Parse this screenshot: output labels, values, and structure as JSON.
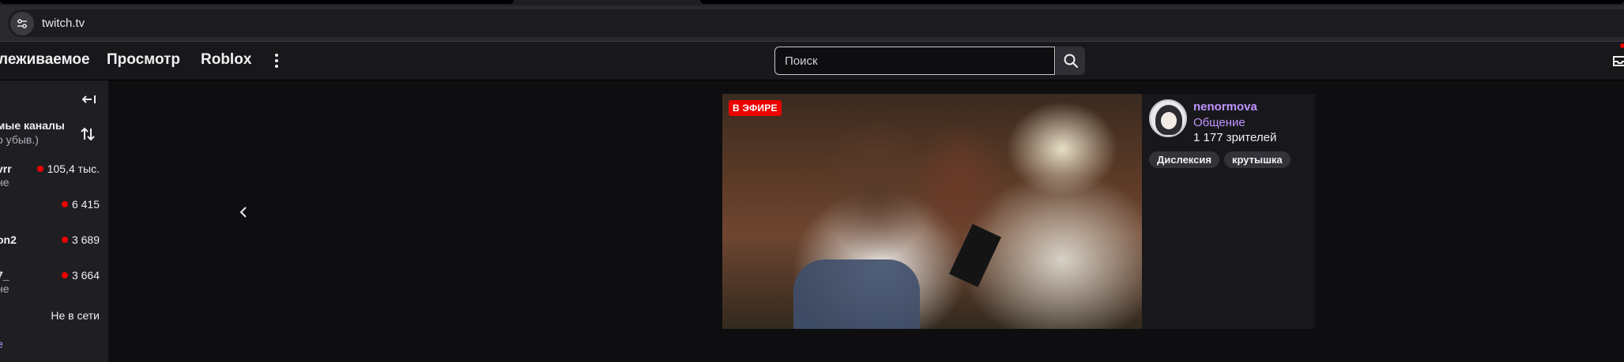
{
  "browser": {
    "url": "twitch.tv"
  },
  "nav": {
    "followed": "леживаемое",
    "browse": "Просмотр",
    "game": "Roblox"
  },
  "search": {
    "placeholder": "Поиск"
  },
  "sidebar": {
    "heading": "мые каналы",
    "sub": "о убыв.)",
    "channels": [
      {
        "name": "vrr",
        "category": "не",
        "viewers": "105,4 тыс."
      },
      {
        "name": "",
        "category": "",
        "viewers": "6 415"
      },
      {
        "name": "on2",
        "category": "",
        "viewers": "3 689"
      },
      {
        "name": "7_",
        "category": "не",
        "viewers": "3 664"
      }
    ],
    "offline_label": "Не в сети",
    "more": "е"
  },
  "featured": {
    "live_label": "В ЭФИРЕ",
    "streamer": "nenormova",
    "category": "Общение",
    "viewers": "1 177 зрителей",
    "tags": [
      "Дислексия",
      "крутышка"
    ]
  },
  "colors": {
    "accent": "#bf94ff",
    "live": "#eb0400",
    "background": "#0e0e10",
    "sidebar": "#1f1f23"
  }
}
